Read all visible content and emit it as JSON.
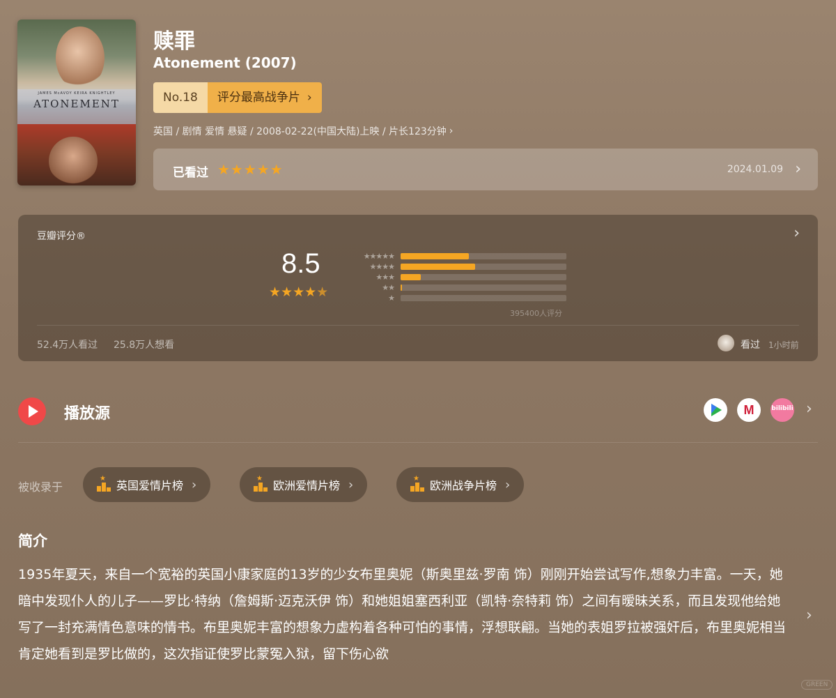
{
  "movie": {
    "title": "赎罪",
    "original_title": "Atonement (2007)",
    "poster": {
      "title_text": "ATONEMENT",
      "cast_text": "JAMES McAVOY   KEIRA KNIGHTLEY"
    },
    "rank": {
      "no": "No.18",
      "label": "评分最高战争片"
    },
    "meta": "英国 / 剧情 爱情 悬疑 / 2008-02-22(中国大陆)上映 / 片长123分钟"
  },
  "my_status": {
    "label": "已看过",
    "stars": 5,
    "stars_text": "★★★★★",
    "date": "2024.01.09"
  },
  "rating": {
    "header": "豆瓣评分®",
    "score": "8.5",
    "stars_text_full": "★★★★",
    "stars_text_half": "★",
    "distribution": [
      {
        "stars": "★★★★★",
        "fraction": 0.41
      },
      {
        "stars": "★★★★",
        "fraction": 0.45
      },
      {
        "stars": "★★★",
        "fraction": 0.12
      },
      {
        "stars": "★★",
        "fraction": 0.01
      },
      {
        "stars": "★",
        "fraction": 0.0
      }
    ],
    "count": "395400人评分",
    "watched": "52.4万人看过",
    "want": "25.8万人想看",
    "friend_action": "看过",
    "friend_time": "1小时前"
  },
  "play": {
    "label": "播放源",
    "sources": [
      "tencent-video",
      "mgtv",
      "bilibili"
    ],
    "bilibili_text": "bilibili"
  },
  "included": {
    "label": "被收录于",
    "lists": [
      "英国爱情片榜",
      "欧洲爱情片榜",
      "欧洲战争片榜"
    ]
  },
  "intro": {
    "heading": "简介",
    "text": "1935年夏天，来自一个宽裕的英国小康家庭的13岁的少女布里奥妮（斯奥里兹·罗南 饰）刚刚开始尝试写作,想象力丰富。一天，她暗中发现仆人的儿子——罗比·特纳（詹姆斯·迈克沃伊 饰）和她姐姐塞西利亚（凯特·奈特莉 饰）之间有暧昧关系，而且发现他给她写了一封充满情色意味的情书。布里奥妮丰富的想象力虚构着各种可怕的事情，浮想联翩。当她的表姐罗拉被强奸后，布里奥妮相当肯定她看到是罗比做的，这次指证使罗比蒙冤入狱，留下伤心欲"
  },
  "watermark": "GREEN",
  "colors": {
    "accent": "#f5a623",
    "rank_bg": "#f0b049",
    "play_red": "#f04848"
  }
}
